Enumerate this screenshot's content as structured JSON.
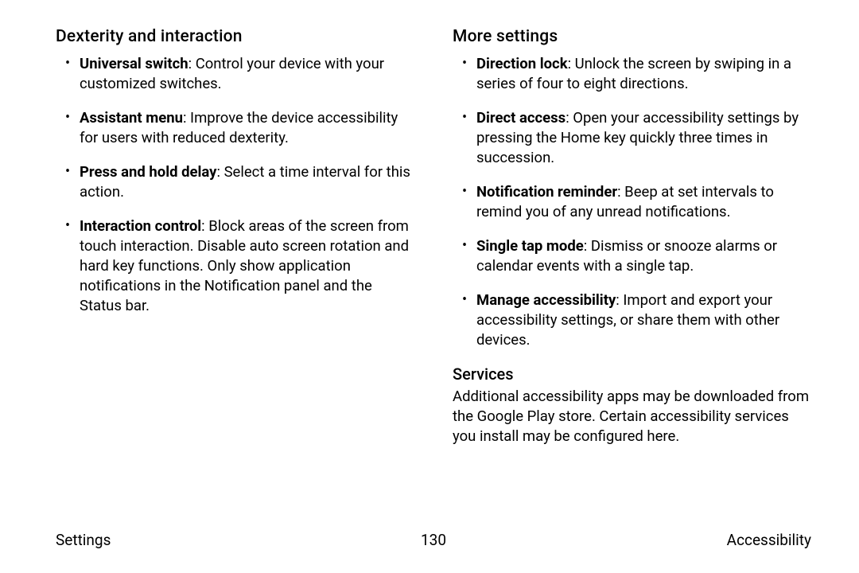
{
  "left": {
    "heading": "Dexterity and interaction",
    "items": [
      {
        "term": "Universal switch",
        "desc": ": Control your device with your customized switches."
      },
      {
        "term": "Assistant menu",
        "desc": ": Improve the device accessibility for users with reduced dexterity."
      },
      {
        "term": "Press and hold delay",
        "desc": ": Select a time interval for this action."
      },
      {
        "term": "Interaction control",
        "desc": ": Block areas of the screen from touch interaction. Disable auto screen rotation and hard key functions. Only show application notifications in the Notification panel and the Status bar."
      }
    ]
  },
  "right": {
    "heading": "More settings",
    "items": [
      {
        "term": "Direction lock",
        "desc": ": Unlock the screen by swiping in a series of four to eight directions."
      },
      {
        "term": "Direct access",
        "desc": ": Open your accessibility settings by pressing the Home key quickly three times in succession."
      },
      {
        "term": "Notification reminder",
        "desc": ": Beep at set intervals to remind you of any unread notifications."
      },
      {
        "term": "Single tap mode",
        "desc": ": Dismiss or snooze alarms or calendar events with a single tap."
      },
      {
        "term": "Manage accessibility",
        "desc": ": Import and export your accessibility settings, or share them with other devices."
      }
    ],
    "sub_heading": "Services",
    "sub_body": "Additional accessibility apps may be downloaded from the Google Play store. Certain accessibility services you install may be configured here."
  },
  "footer": {
    "left": "Settings",
    "center": "130",
    "right": "Accessibility"
  }
}
